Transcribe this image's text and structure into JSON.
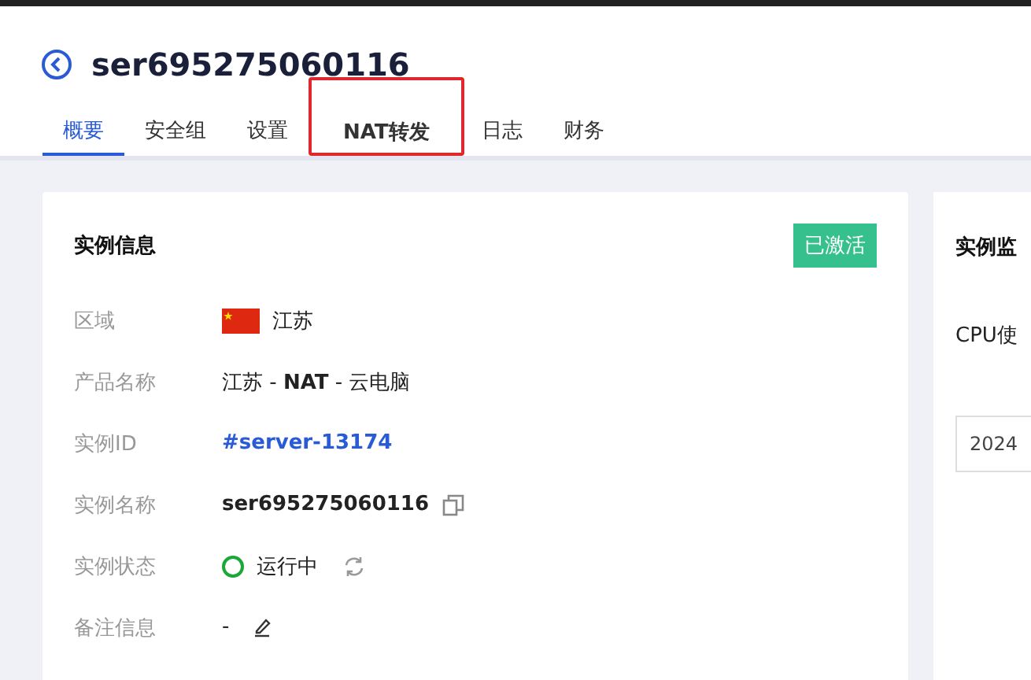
{
  "header": {
    "title": "ser695275060116"
  },
  "tabs": [
    {
      "label": "概要",
      "selected": true,
      "highlighted": false
    },
    {
      "label": "安全组",
      "selected": false,
      "highlighted": false
    },
    {
      "label": "设置",
      "selected": false,
      "highlighted": false
    },
    {
      "label": "NAT转发",
      "selected": false,
      "highlighted": true
    },
    {
      "label": "日志",
      "selected": false,
      "highlighted": false
    },
    {
      "label": "财务",
      "selected": false,
      "highlighted": false
    }
  ],
  "info_card": {
    "title": "实例信息",
    "badge": "已激活",
    "rows": [
      {
        "kind": "flag",
        "label": "区域",
        "value": "江苏"
      },
      {
        "kind": "rich",
        "label": "产品名称",
        "value": "江苏 - **NAT** - 云电脑"
      },
      {
        "kind": "link",
        "label": "实例ID",
        "value": "#server-13174"
      },
      {
        "kind": "copy",
        "label": "实例名称",
        "value": "ser695275060116"
      },
      {
        "kind": "status",
        "label": "实例状态",
        "value": "运行中"
      },
      {
        "kind": "edit",
        "label": "备注信息",
        "value": "-"
      }
    ]
  },
  "monitor_card": {
    "title": "实例监",
    "metric": "CPU使",
    "date_field": "2024"
  }
}
